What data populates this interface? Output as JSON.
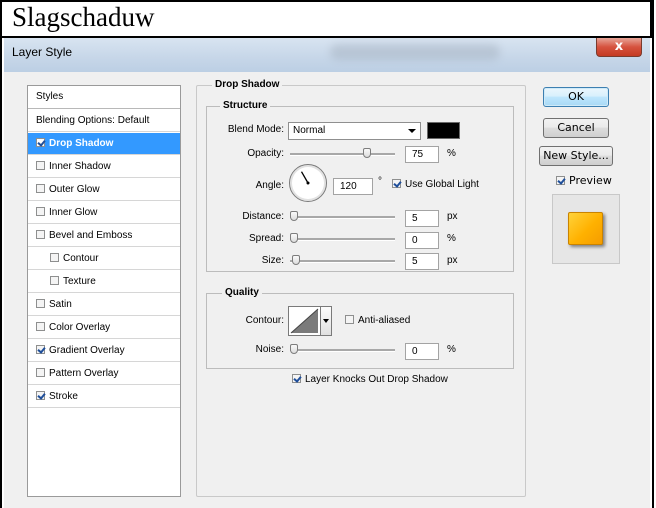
{
  "document": {
    "title": "Slagschaduw"
  },
  "window": {
    "title": "Layer Style",
    "close_glyph": "x"
  },
  "styles_panel": {
    "header": "Styles",
    "items": [
      {
        "label": "Blending Options: Default",
        "has_checkbox": false,
        "checked": false,
        "selected": false,
        "indent": false
      },
      {
        "label": "Drop Shadow",
        "has_checkbox": true,
        "checked": true,
        "selected": true,
        "indent": false
      },
      {
        "label": "Inner Shadow",
        "has_checkbox": true,
        "checked": false,
        "selected": false,
        "indent": false
      },
      {
        "label": "Outer Glow",
        "has_checkbox": true,
        "checked": false,
        "selected": false,
        "indent": false
      },
      {
        "label": "Inner Glow",
        "has_checkbox": true,
        "checked": false,
        "selected": false,
        "indent": false
      },
      {
        "label": "Bevel and Emboss",
        "has_checkbox": true,
        "checked": false,
        "selected": false,
        "indent": false
      },
      {
        "label": "Contour",
        "has_checkbox": true,
        "checked": false,
        "selected": false,
        "indent": true
      },
      {
        "label": "Texture",
        "has_checkbox": true,
        "checked": false,
        "selected": false,
        "indent": true
      },
      {
        "label": "Satin",
        "has_checkbox": true,
        "checked": false,
        "selected": false,
        "indent": false
      },
      {
        "label": "Color Overlay",
        "has_checkbox": true,
        "checked": false,
        "selected": false,
        "indent": false
      },
      {
        "label": "Gradient Overlay",
        "has_checkbox": true,
        "checked": true,
        "selected": false,
        "indent": false
      },
      {
        "label": "Pattern Overlay",
        "has_checkbox": true,
        "checked": false,
        "selected": false,
        "indent": false
      },
      {
        "label": "Stroke",
        "has_checkbox": true,
        "checked": true,
        "selected": false,
        "indent": false
      }
    ]
  },
  "drop_shadow": {
    "section_title": "Drop Shadow",
    "structure": {
      "title": "Structure",
      "blend_mode": {
        "label": "Blend Mode:",
        "value": "Normal",
        "color": "#000000"
      },
      "opacity": {
        "label": "Opacity:",
        "value": "75",
        "unit": "%",
        "level": 0.75
      },
      "angle": {
        "label": "Angle:",
        "value": "120",
        "unit": "°",
        "degrees": 120,
        "use_global_light": {
          "label": "Use Global Light",
          "checked": true
        }
      },
      "distance": {
        "label": "Distance:",
        "value": "5",
        "unit": "px",
        "level": 0.0
      },
      "spread": {
        "label": "Spread:",
        "value": "0",
        "unit": "%",
        "level": 0.0
      },
      "size": {
        "label": "Size:",
        "value": "5",
        "unit": "px",
        "level": 0.02
      }
    },
    "quality": {
      "title": "Quality",
      "contour": {
        "label": "Contour:",
        "anti_aliased": {
          "label": "Anti-aliased",
          "checked": false
        }
      },
      "noise": {
        "label": "Noise:",
        "value": "0",
        "unit": "%",
        "level": 0.0
      }
    },
    "knockout": {
      "label": "Layer Knocks Out Drop Shadow",
      "checked": true
    }
  },
  "buttons": {
    "ok": "OK",
    "cancel": "Cancel",
    "new_style": "New Style..."
  },
  "preview": {
    "label": "Preview",
    "checked": true,
    "swatch_color": "#ffb800"
  }
}
